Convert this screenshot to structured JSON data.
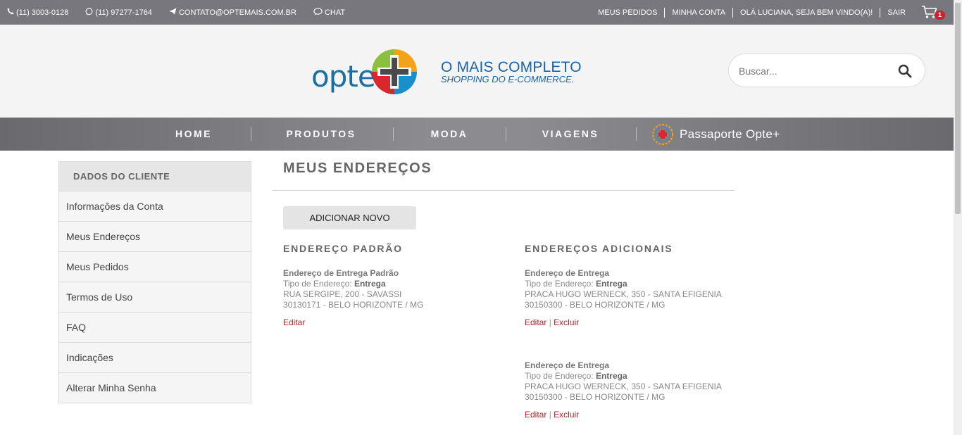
{
  "topbar": {
    "phone": "(11) 3003-0128",
    "whatsapp": "(11) 97277-1764",
    "email": "CONTATO@OPTEMAIS.COM.BR",
    "chat": "CHAT",
    "meus_pedidos": "MEUS PEDIDOS",
    "minha_conta": "MINHA CONTA",
    "greeting": "OLÁ LUCIANA, SEJA BEM VINDO(A)!",
    "sair": "SAIR",
    "cart_count": "1"
  },
  "header": {
    "logo_text": "opte.",
    "tagline_line1": "O MAIS COMPLETO",
    "tagline_line2": "SHOPPING DO E-COMMERCE.",
    "search_placeholder": "Buscar..."
  },
  "nav": {
    "items": [
      "HOME",
      "PRODUTOS",
      "MODA",
      "VIAGENS"
    ],
    "passaporte": "Passaporte Opte+"
  },
  "sidebar": {
    "header": "DADOS DO CLIENTE",
    "items": [
      "Informações da Conta",
      "Meus Endereços",
      "Meus Pedidos",
      "Termos de Uso",
      "FAQ",
      "Indicações",
      "Alterar Minha Senha"
    ]
  },
  "main": {
    "title": "MEUS ENDEREÇOS",
    "add_button": "ADICIONAR NOVO",
    "default_section": "ENDEREÇO PADRÃO",
    "additional_section": "ENDEREÇOS ADICIONAIS",
    "addresses": [
      {
        "name": "Endereço de Entrega Padrão",
        "tipo_label": "Tipo de Endereço:",
        "tipo_value": "Entrega",
        "street": "RUA SERGIPE, 200 - SAVASSI",
        "city": "30130171 - BELO HORIZONTE / MG",
        "edit": "Editar"
      },
      {
        "name": "Endereço de Entrega",
        "tipo_label": "Tipo de Endereço:",
        "tipo_value": "Entrega",
        "street": "PRACA HUGO WERNECK, 350 - SANTA EFIGENIA",
        "city": "30150300 - BELO HORIZONTE / MG",
        "edit": "Editar",
        "delete": "Excluir"
      },
      {
        "name": "Endereço de Entrega",
        "tipo_label": "Tipo de Endereço:",
        "tipo_value": "Entrega",
        "street": "PRACA HUGO WERNECK, 350 - SANTA EFIGENIA",
        "city": "30150300 - BELO HORIZONTE / MG",
        "edit": "Editar",
        "delete": "Excluir"
      }
    ]
  },
  "colors": {
    "topbar": "#77777d",
    "brand_blue": "#1a63a6",
    "link_red": "#b32424",
    "badge_red": "#d0202e"
  }
}
